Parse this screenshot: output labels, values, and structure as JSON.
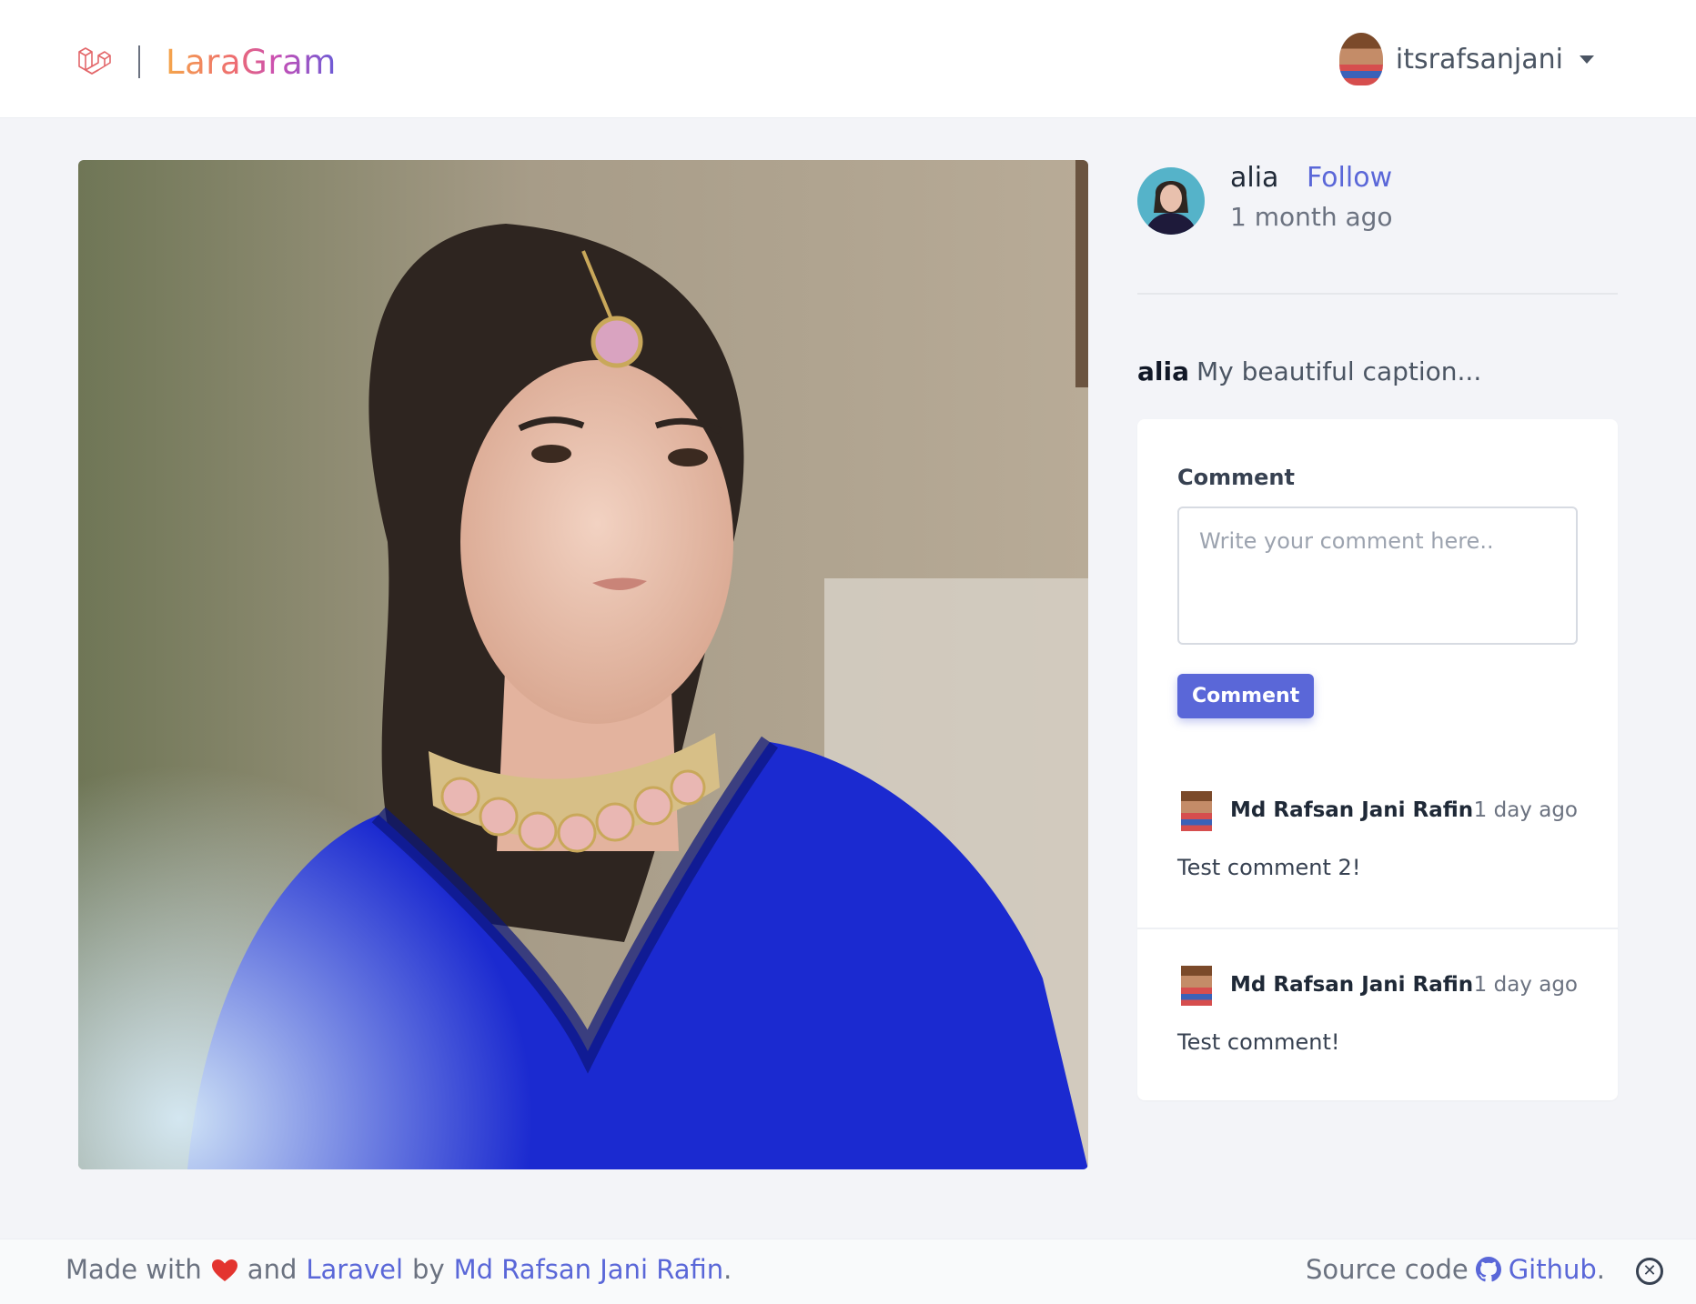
{
  "navbar": {
    "app_name": "LaraGram",
    "username": "itsrafsanjani",
    "icons": {
      "logo": "laravel-logo-icon",
      "caret": "chevron-down-icon"
    }
  },
  "post": {
    "author": "alia",
    "follow_label": "Follow",
    "time": "1 month ago",
    "caption_user": "alia",
    "caption_text": "My beautiful caption..."
  },
  "comment_form": {
    "label": "Comment",
    "placeholder": "Write your comment here..",
    "value": "",
    "button_label": "Comment"
  },
  "comments": [
    {
      "author": "Md Rafsan Jani Rafin",
      "time": "1 day ago",
      "text": "Test comment 2!"
    },
    {
      "author": "Md Rafsan Jani Rafin",
      "time": "1 day ago",
      "text": "Test comment!"
    }
  ],
  "footer": {
    "made_with": "Made with",
    "and": "and",
    "laravel_link": "Laravel",
    "by": "by",
    "author_link": "Md Rafsan Jani Rafin",
    "period1": ".",
    "source_code": "Source code",
    "github_link": "Github",
    "period2": ".",
    "icons": {
      "heart": "heart-icon",
      "github": "github-icon",
      "close": "close-circle-icon"
    }
  },
  "colors": {
    "accent": "#5a67d8",
    "background": "#f3f4f8",
    "heart": "#e3342f"
  }
}
